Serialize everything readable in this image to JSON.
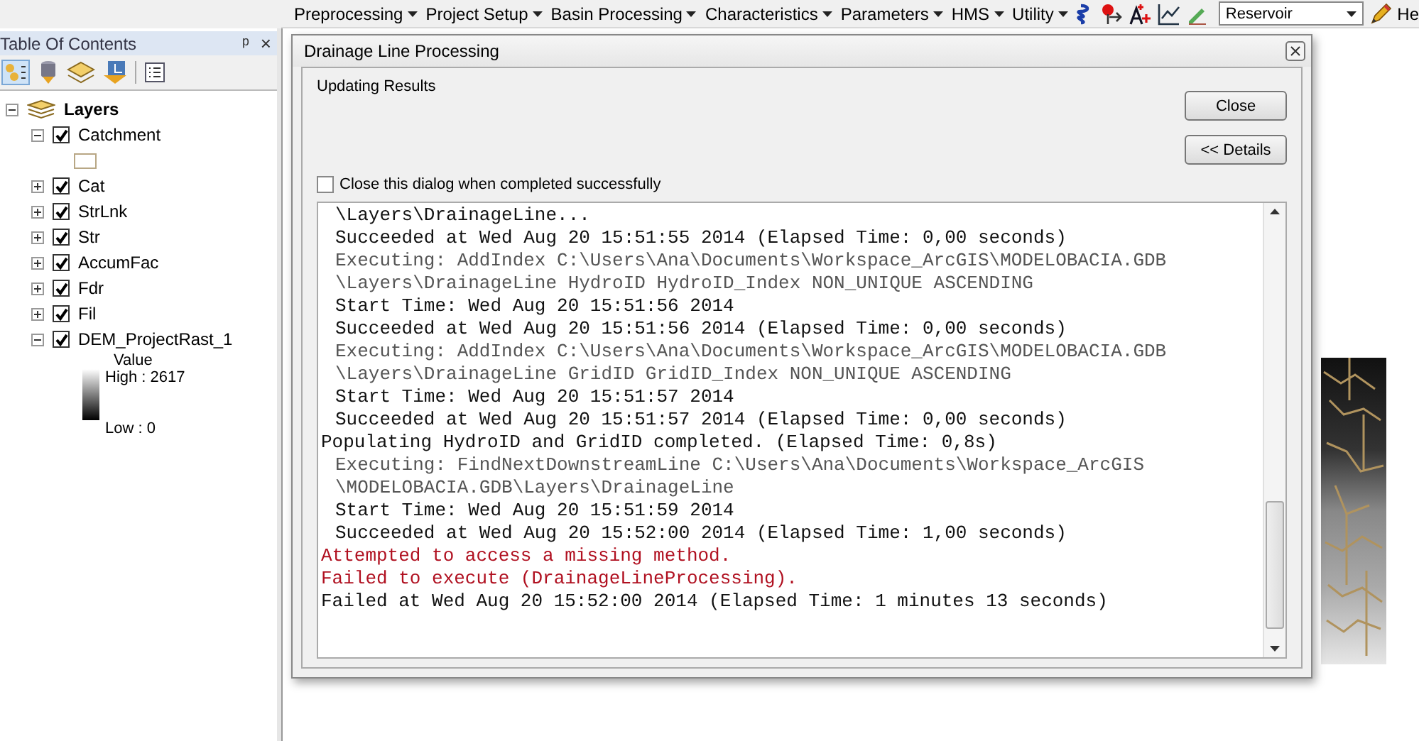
{
  "toolbar": {
    "menus": [
      {
        "label": "Preprocessing"
      },
      {
        "label": "Project Setup"
      },
      {
        "label": "Basin Processing"
      },
      {
        "label": "Characteristics"
      },
      {
        "label": "Parameters"
      },
      {
        "label": "HMS"
      },
      {
        "label": "Utility"
      }
    ],
    "dropdown": {
      "value": "Reservoir"
    },
    "cut_label": "He"
  },
  "toc": {
    "title": "Table Of Contents",
    "pin": "ᵖ",
    "close": "×",
    "root": {
      "label": "Layers",
      "expanded": true,
      "children": [
        {
          "label": "Catchment",
          "checked": true,
          "expanded": true,
          "legend": {
            "kind": "swatch"
          }
        },
        {
          "label": "Cat",
          "checked": true,
          "expanded": false
        },
        {
          "label": "StrLnk",
          "checked": true,
          "expanded": false
        },
        {
          "label": "Str",
          "checked": true,
          "expanded": false
        },
        {
          "label": "AccumFac",
          "checked": true,
          "expanded": false
        },
        {
          "label": "Fdr",
          "checked": true,
          "expanded": false
        },
        {
          "label": "Fil",
          "checked": true,
          "expanded": false
        },
        {
          "label": "DEM_ProjectRast_1",
          "checked": true,
          "expanded": true,
          "legend": {
            "kind": "ramp",
            "title": "Value",
            "high": "High : 2617",
            "low": "Low : 0"
          }
        }
      ]
    }
  },
  "dialog": {
    "title": "Drainage Line Processing",
    "status": "Updating Results",
    "buttons": [
      {
        "label": "Close"
      },
      {
        "label": "<< Details"
      }
    ],
    "close_option": {
      "label": "Close this dialog when completed successfully",
      "checked": false
    },
    "log": [
      {
        "kind": "info",
        "text": "\\Layers\\DrainageLine..."
      },
      {
        "kind": "info",
        "text": "Succeeded at Wed Aug 20 15:51:55 2014 (Elapsed Time: 0,00 seconds)"
      },
      {
        "kind": "exec",
        "text": "Executing: AddIndex C:\\Users\\Ana\\Documents\\Workspace_ArcGIS\\MODELOBACIA.GDB"
      },
      {
        "kind": "exec",
        "text": "\\Layers\\DrainageLine HydroID HydroID_Index NON_UNIQUE ASCENDING"
      },
      {
        "kind": "info",
        "text": "Start Time: Wed Aug 20 15:51:56 2014"
      },
      {
        "kind": "info",
        "text": "Succeeded at Wed Aug 20 15:51:56 2014 (Elapsed Time: 0,00 seconds)"
      },
      {
        "kind": "exec",
        "text": "Executing: AddIndex C:\\Users\\Ana\\Documents\\Workspace_ArcGIS\\MODELOBACIA.GDB"
      },
      {
        "kind": "exec",
        "text": "\\Layers\\DrainageLine GridID GridID_Index NON_UNIQUE ASCENDING"
      },
      {
        "kind": "info",
        "text": "Start Time: Wed Aug 20 15:51:57 2014"
      },
      {
        "kind": "info",
        "text": "Succeeded at Wed Aug 20 15:51:57 2014 (Elapsed Time: 0,00 seconds)"
      },
      {
        "kind": "plain",
        "text": "Populating HydroID and GridID completed. (Elapsed Time: 0,8s)"
      },
      {
        "kind": "exec",
        "text": "Executing: FindNextDownstreamLine C:\\Users\\Ana\\Documents\\Workspace_ArcGIS"
      },
      {
        "kind": "exec",
        "text": "\\MODELOBACIA.GDB\\Layers\\DrainageLine"
      },
      {
        "kind": "info",
        "text": "Start Time: Wed Aug 20 15:51:59 2014"
      },
      {
        "kind": "info",
        "text": "Succeeded at Wed Aug 20 15:52:00 2014 (Elapsed Time: 1,00 seconds)"
      },
      {
        "kind": "error",
        "text": "Attempted to access a missing method."
      },
      {
        "kind": "error",
        "text": "Failed to execute (DrainageLineProcessing)."
      },
      {
        "kind": "plain",
        "text": "Failed at Wed Aug 20 15:52:00 2014 (Elapsed Time: 1 minutes 13 seconds)"
      }
    ]
  }
}
